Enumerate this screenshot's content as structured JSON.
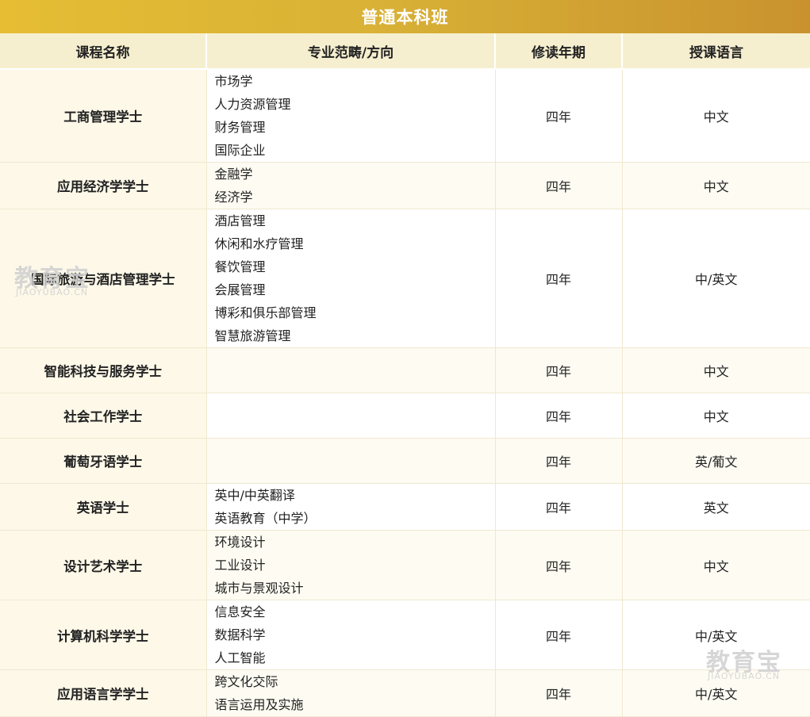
{
  "banner": {
    "title": "普通本科班"
  },
  "headers": [
    "课程名称",
    "专业范畴/方向",
    "修读年期",
    "授课语言"
  ],
  "rows": [
    {
      "name": "工商管理学士",
      "specs": [
        "市场学",
        "人力资源管理",
        "财务管理",
        "国际企业"
      ],
      "years": "四年",
      "language": "中文"
    },
    {
      "name": "应用经济学学士",
      "specs": [
        "金融学",
        "经济学"
      ],
      "years": "四年",
      "language": "中文"
    },
    {
      "name": "国际旅游与酒店管理学士",
      "specs": [
        "酒店管理",
        "休闲和水疗管理",
        "餐饮管理",
        "会展管理",
        "博彩和俱乐部管理",
        "智慧旅游管理"
      ],
      "years": "四年",
      "language": "中/英文"
    },
    {
      "name": "智能科技与服务学士",
      "specs": [],
      "years": "四年",
      "language": "中文"
    },
    {
      "name": "社会工作学士",
      "specs": [],
      "years": "四年",
      "language": "中文"
    },
    {
      "name": "葡萄牙语学士",
      "specs": [],
      "years": "四年",
      "language": "英/葡文"
    },
    {
      "name": "英语学士",
      "specs": [
        "英中/中英翻译",
        "英语教育（中学）"
      ],
      "years": "四年",
      "language": "英文"
    },
    {
      "name": "设计艺术学士",
      "specs": [
        "环境设计",
        "工业设计",
        "城市与景观设计"
      ],
      "years": "四年",
      "language": "中文"
    },
    {
      "name": "计算机科学学士",
      "specs": [
        "信息安全",
        "数据科学",
        "人工智能"
      ],
      "years": "四年",
      "language": "中/英文"
    },
    {
      "name": "应用语言学学士",
      "specs": [
        "跨文化交际",
        "语言运用及实施"
      ],
      "years": "四年",
      "language": "中/英文"
    }
  ],
  "watermarks": [
    {
      "main": "教育宝",
      "sub": "JIAOYUBAO.CN"
    },
    {
      "main": "教育宝",
      "sub": "JIAOYUBAO.CN"
    }
  ]
}
